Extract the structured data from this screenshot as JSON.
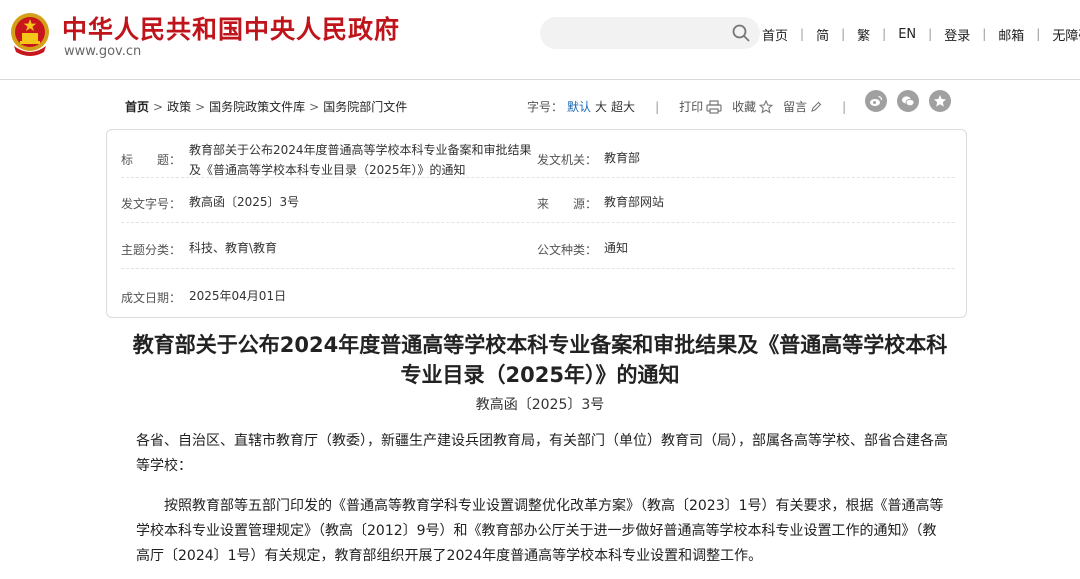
{
  "site": {
    "title": "中华人民共和国中央人民政府",
    "url": "www.gov.cn",
    "brand_color": "#c0141b"
  },
  "search": {
    "placeholder": "",
    "icon": "search-icon"
  },
  "top_nav": [
    "首页",
    "简",
    "繁",
    "EN",
    "登录",
    "邮箱",
    "无障碍"
  ],
  "breadcrumb": [
    "首页",
    "政策",
    "国务院政策文件库",
    "国务院部门文件"
  ],
  "tools": {
    "font_size_label": "字号：",
    "font_default": "默认",
    "font_large": "大",
    "font_xlarge": "超大",
    "print": "打印",
    "favorite": "收藏",
    "comment": "留言",
    "share_icons": [
      "weibo-icon",
      "wechat-icon",
      "qzone-icon"
    ]
  },
  "info": {
    "title_label": "标　　题：",
    "title_value": "教育部关于公布2024年度普通高等学校本科专业备案和审批结果及《普通高等学校本科专业目录（2025年）》的通知",
    "issuer_label": "发文机关：",
    "issuer_value": "教育部",
    "doc_no_label": "发文字号：",
    "doc_no_value": "教高函〔2025〕3号",
    "source_label": "来　　源：",
    "source_value": "教育部网站",
    "topic_label": "主题分类：",
    "topic_value": "科技、教育\\教育",
    "type_label": "公文种类：",
    "type_value": "通知",
    "date_label": "成文日期：",
    "date_value": "2025年04月01日"
  },
  "article": {
    "title": "教育部关于公布2024年度普通高等学校本科专业备案和审批结果及《普通高等学校本科专业目录（2025年）》的通知",
    "doc_no": "教高函〔2025〕3号",
    "para1": "各省、自治区、直辖市教育厅（教委），新疆生产建设兵团教育局，有关部门（单位）教育司（局），部属各高等学校、部省合建各高等学校：",
    "para2": "按照教育部等五部门印发的《普通高等教育学科专业设置调整优化改革方案》（教高〔2023〕1号）有关要求，根据《普通高等学校本科专业设置管理规定》（教高〔2012〕9号）和《教育部办公厅关于进一步做好普通高等学校本科专业设置工作的通知》（教高厅〔2024〕1号）有关规定，教育部组织开展了2024年度普通高等学校本科专业设置和调整工作。"
  }
}
